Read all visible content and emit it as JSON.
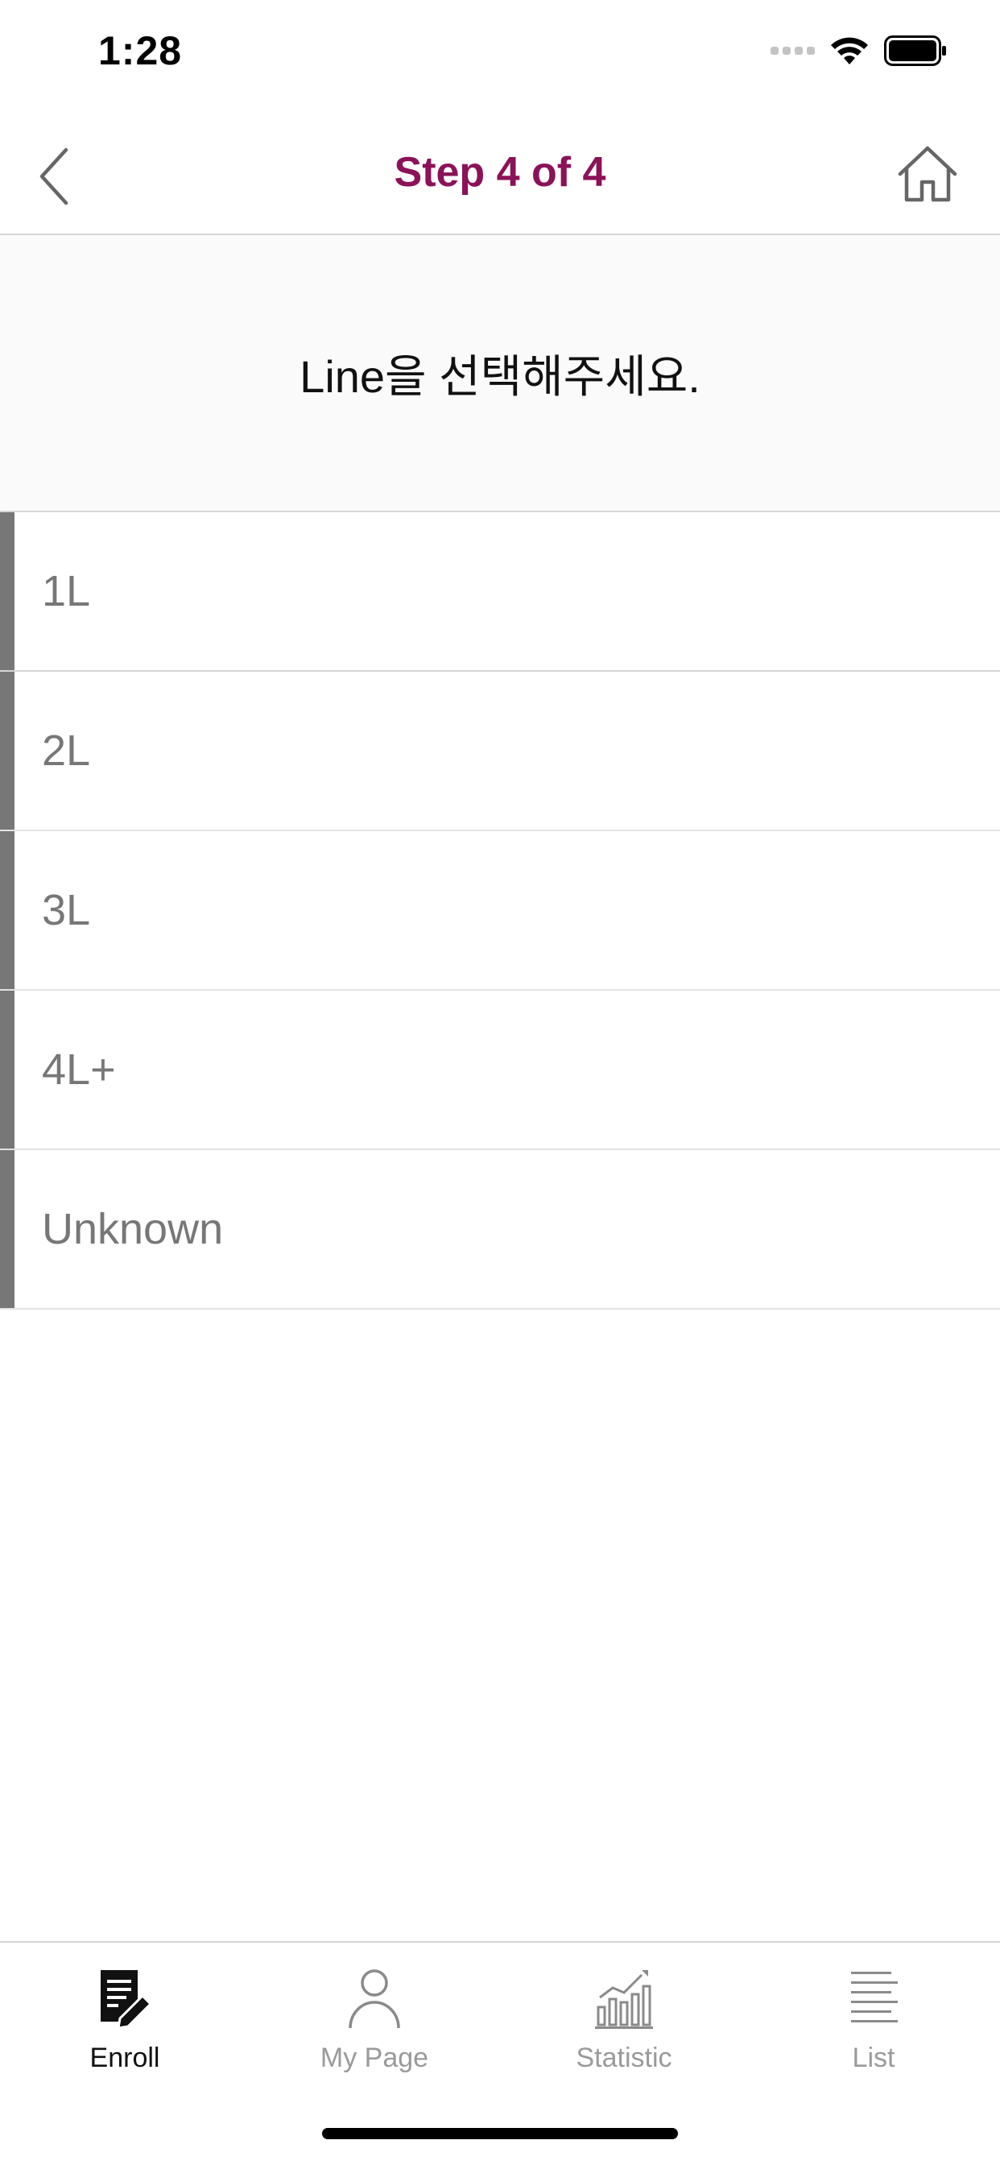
{
  "status_bar": {
    "time": "1:28"
  },
  "nav": {
    "title": "Step 4 of 4",
    "title_color": "#8b1258",
    "back_icon": "chevron-left-icon",
    "home_icon": "home-icon"
  },
  "prompt": {
    "text": "Line을 선택해주세요."
  },
  "options": [
    {
      "label": "1L"
    },
    {
      "label": "2L"
    },
    {
      "label": "3L"
    },
    {
      "label": "4L+"
    },
    {
      "label": "Unknown"
    }
  ],
  "tabs": [
    {
      "label": "Enroll",
      "icon": "enroll-icon",
      "active": true
    },
    {
      "label": "My Page",
      "icon": "person-icon",
      "active": false
    },
    {
      "label": "Statistic",
      "icon": "chart-icon",
      "active": false
    },
    {
      "label": "List",
      "icon": "list-icon",
      "active": false
    }
  ]
}
